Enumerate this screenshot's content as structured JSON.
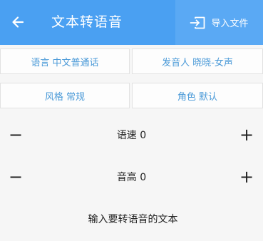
{
  "colors": {
    "header_bg": "#4aa0f2",
    "import_bg": "#5aa9f4",
    "option_text": "#4b9ad8"
  },
  "header": {
    "back_icon": "arrow-left-icon",
    "title": "文本转语音",
    "import_icon": "import-file-icon",
    "import_label": "导入文件"
  },
  "options": {
    "language": "语言 中文普通话",
    "speaker": "发音人 晓晓-女声",
    "style": "风格 常规",
    "role": "角色 默认"
  },
  "speed": {
    "minus": "−",
    "label": "语速 0",
    "plus": "+"
  },
  "pitch": {
    "minus": "−",
    "label": "音高 0",
    "plus": "+"
  },
  "text_input": {
    "placeholder": "输入要转语音的文本",
    "value": ""
  }
}
